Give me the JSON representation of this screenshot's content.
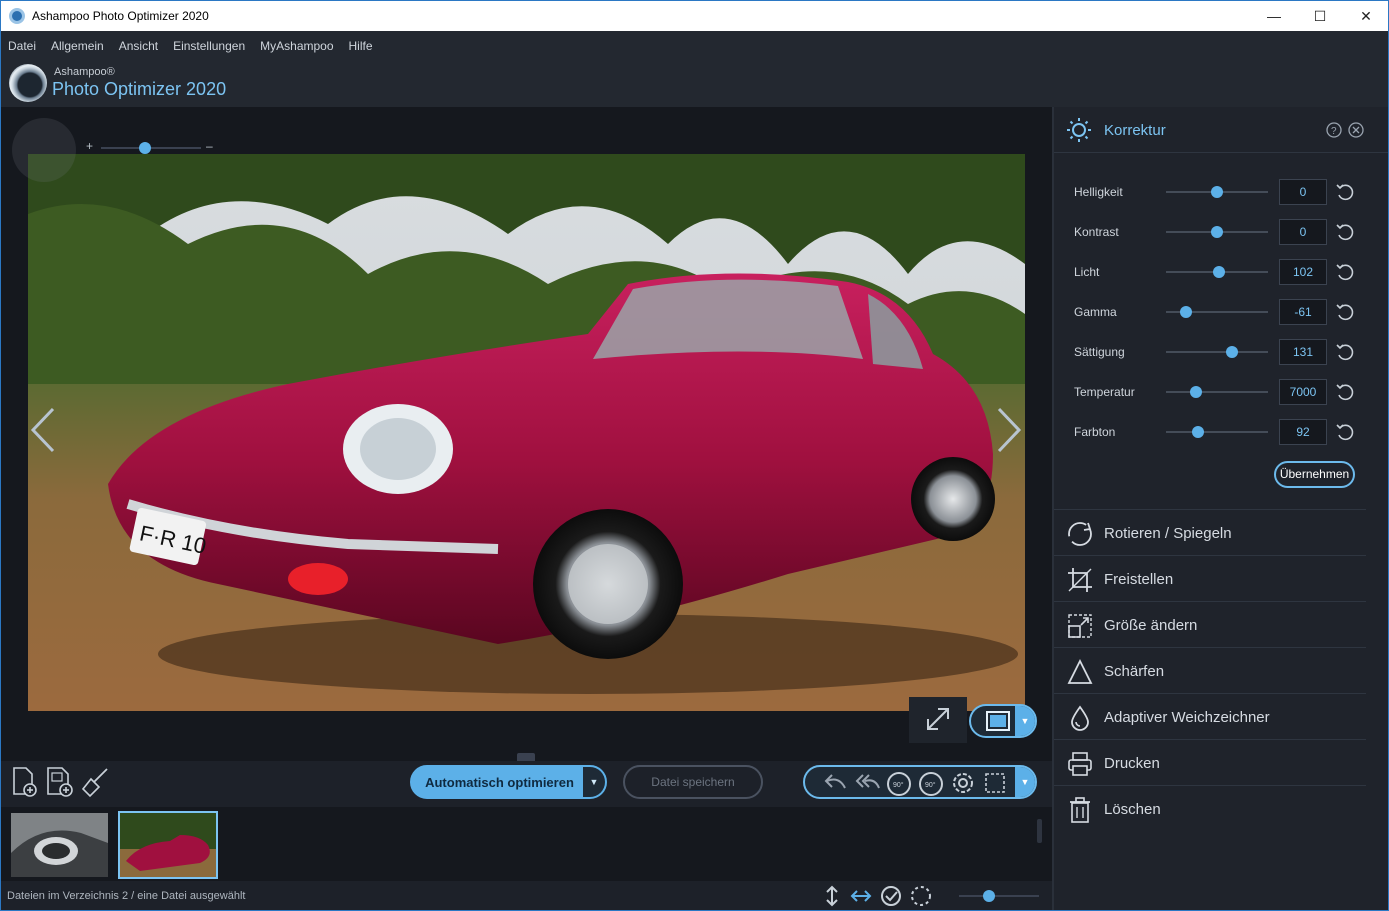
{
  "window": {
    "title": "Ashampoo Photo Optimizer 2020"
  },
  "menu": [
    "Datei",
    "Allgemein",
    "Ansicht",
    "Einstellungen",
    "MyAshampoo",
    "Hilfe"
  ],
  "brand": {
    "vendor": "Ashampoo®",
    "product": "Photo Optimizer 2020"
  },
  "zoom": {
    "plus": "+",
    "minus": "–",
    "level_fraction": 0.44
  },
  "bottom": {
    "auto_label": "Automatisch optimieren",
    "save_label": "Datei speichern"
  },
  "status": {
    "text": "Dateien im Verzeichnis 2 / eine Datei ausgewählt",
    "thumb_size_fraction": 0.38
  },
  "panel": {
    "title": "Korrektur",
    "sliders": [
      {
        "label": "Helligkeit",
        "value": "0",
        "pos": 0.5
      },
      {
        "label": "Kontrast",
        "value": "0",
        "pos": 0.5
      },
      {
        "label": "Licht",
        "value": "102",
        "pos": 0.52
      },
      {
        "label": "Gamma",
        "value": "-61",
        "pos": 0.2
      },
      {
        "label": "Sättigung",
        "value": "131",
        "pos": 0.65
      },
      {
        "label": "Temperatur",
        "value": "7000",
        "pos": 0.29
      },
      {
        "label": "Farbton",
        "value": "92",
        "pos": 0.31
      }
    ],
    "apply_label": "Übernehmen",
    "tools": [
      {
        "label": "Rotieren / Spiegeln",
        "icon": "rotate-icon"
      },
      {
        "label": "Freistellen",
        "icon": "crop-icon"
      },
      {
        "label": "Größe ändern",
        "icon": "resize-icon"
      },
      {
        "label": "Schärfen",
        "icon": "sharpen-icon"
      },
      {
        "label": "Adaptiver Weichzeichner",
        "icon": "drop-icon"
      },
      {
        "label": "Drucken",
        "icon": "print-icon"
      },
      {
        "label": "Löschen",
        "icon": "trash-icon"
      }
    ]
  },
  "colors": {
    "accent": "#5cb0e8",
    "panel_bg": "#1f232b",
    "car": "#a0103f"
  }
}
